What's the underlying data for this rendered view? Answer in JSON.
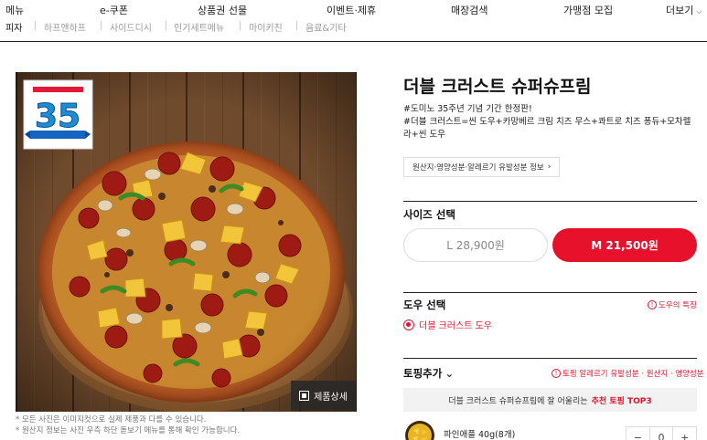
{
  "topnav": {
    "items": [
      "메뉴",
      "e-쿠폰",
      "상품권 선물",
      "이벤트·제휴",
      "매장검색",
      "가맹점 모집",
      "더보기"
    ]
  },
  "subnav": {
    "items": [
      "피자",
      "하프앤하프",
      "사이드디시",
      "인기세트메뉴",
      "마이키친",
      "음료&기타"
    ]
  },
  "product": {
    "badge_number": "35",
    "zoom_label": "제품상세",
    "notes": [
      "* 모든 사진은 이미지컷으로 실제 제품과 다를 수 있습니다.",
      "* 원산지 정보는 사진 우측 하단 돋보기 메뉴를 통해 확인 가능합니다."
    ],
    "title": "더블 크러스트 슈퍼슈프림",
    "desc_line1": "#도미노 35주년 기념 기간 한정판!",
    "desc_line2": "#더블 크러스트=씬 도우+카망베르 크림 치즈 무스+콰트로 치즈 퐁듀+모차렐라+씬 도우",
    "origin_button": "원산지·영양성분·알레르기 유발성분 정보"
  },
  "size": {
    "title": "사이즈 선택",
    "options": [
      "L 28,900원",
      "M 21,500원"
    ],
    "selected": "M 21,500원"
  },
  "dough": {
    "title": "도우 선택",
    "info_label": "도우의 특징",
    "option": "더블 크러스트 도우"
  },
  "topping": {
    "title": "토핑추가",
    "info_label": "토핑 알레르기 유발성분 · 원산지 · 영양성분",
    "reco_text": "더블 크러스트 슈퍼슈프림에 잘 어울리는",
    "reco_highlight": "추천 토핑 TOP3",
    "item_name": "파인애플 40g(8개)",
    "quantity": "0"
  },
  "colors": {
    "accent": "#e8112b",
    "text": "#111111",
    "muted": "#888888"
  }
}
